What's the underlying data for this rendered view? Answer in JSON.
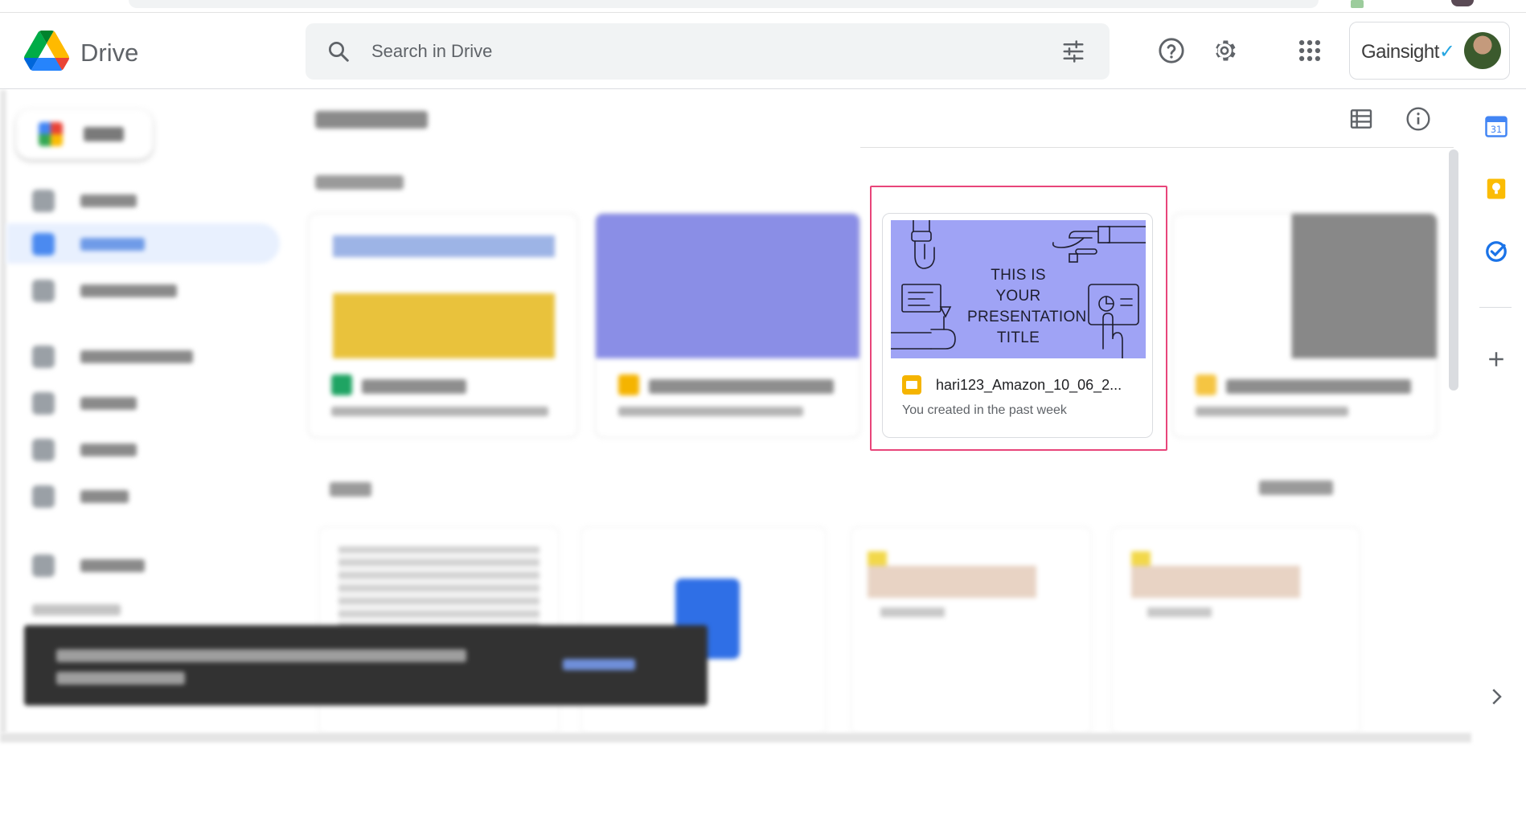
{
  "app": {
    "title": "Drive"
  },
  "search": {
    "placeholder": "Search in Drive"
  },
  "account": {
    "org_name": "Gainsight"
  },
  "focused_card": {
    "thumbnail_title": "THIS IS YOUR PRESENTATION TITLE",
    "file_name": "hari123_Amazon_10_06_2...",
    "subtitle": "You created in the past week",
    "file_type_icon": "slides-icon"
  },
  "icons": {
    "search": "search-icon",
    "tune": "tune-icon",
    "help": "help-icon",
    "settings": "gear-icon",
    "apps": "apps-grid-icon",
    "list_view": "list-view-icon",
    "info": "info-icon",
    "calendar": "calendar-icon",
    "keep": "keep-icon",
    "tasks": "tasks-icon",
    "add": "plus-icon",
    "expand": "chevron-right-icon"
  },
  "colors": {
    "highlight": "#e8457a",
    "thumbnail_bg": "#9fa3f5",
    "slides": "#f5b400",
    "active_nav": "#e8f0fe"
  }
}
